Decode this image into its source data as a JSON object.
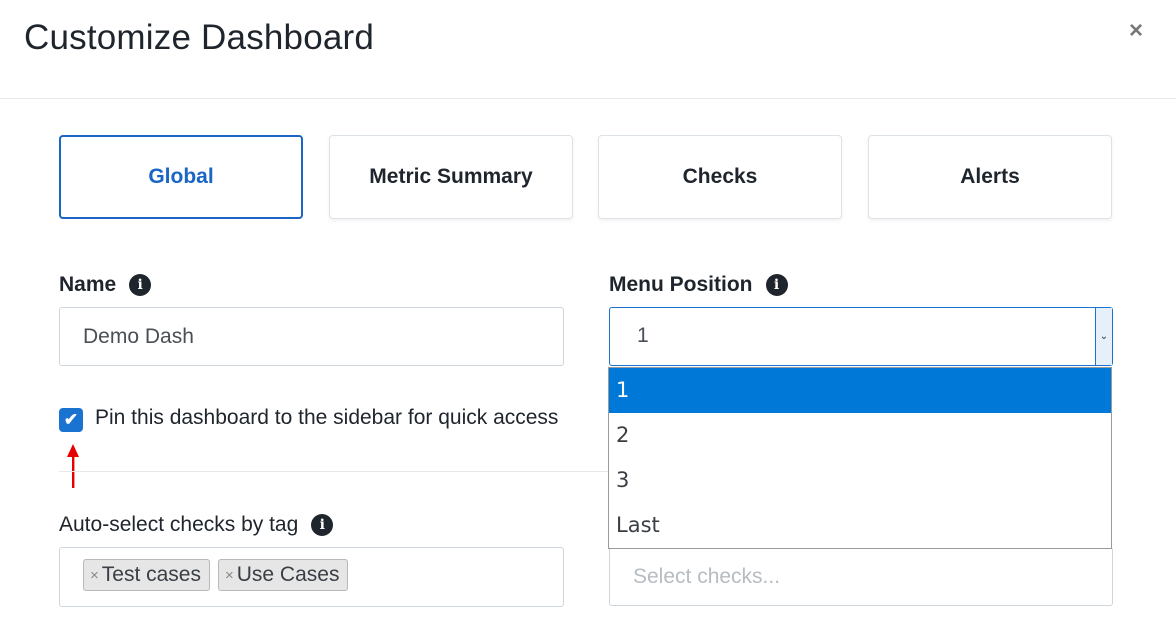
{
  "modal": {
    "title": "Customize Dashboard",
    "close_icon": "×"
  },
  "tabs": [
    {
      "label": "Global",
      "active": true
    },
    {
      "label": "Metric Summary",
      "active": false
    },
    {
      "label": "Checks",
      "active": false
    },
    {
      "label": "Alerts",
      "active": false
    }
  ],
  "name_field": {
    "label": "Name",
    "info_icon": "i",
    "value": "Demo Dash"
  },
  "menu_position": {
    "label": "Menu Position",
    "info_icon": "i",
    "selected": "1",
    "arrow_icon": "⌄",
    "options": [
      "1",
      "2",
      "3",
      "Last"
    ]
  },
  "pin": {
    "checked": true,
    "check_icon": "✔",
    "label": "Pin this dashboard to the sidebar for quick access"
  },
  "auto_select": {
    "label": "Auto-select checks by tag",
    "info_icon": "i",
    "tags": [
      {
        "label": "Test cases",
        "remove_icon": "×"
      },
      {
        "label": "Use Cases",
        "remove_icon": "×"
      }
    ]
  },
  "select_checks": {
    "placeholder": "Select checks..."
  },
  "colors": {
    "accent": "#1a65c6",
    "dropdown_highlight": "#0078d7",
    "annotation_arrow": "#e60000"
  }
}
